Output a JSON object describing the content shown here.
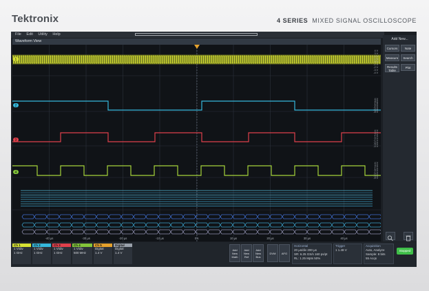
{
  "header": {
    "brand": "Tektronix",
    "series": "4 SERIES",
    "subtitle": "MIXED SIGNAL OSCILLOSCOPE"
  },
  "menu": [
    "File",
    "Edit",
    "Utility",
    "Help"
  ],
  "waveform_view": {
    "title": "Waveform View"
  },
  "side_panel": {
    "title": "Add New...",
    "buttons": [
      "Cursors",
      "Note",
      "Measure",
      "Search",
      "Results Table",
      "Plot"
    ]
  },
  "time_axis": {
    "labels": [
      "-40 µs",
      "-30 µs",
      "-20 µs",
      "-10 µs",
      "0 s",
      "10 µs",
      "20 µs",
      "30 µs",
      "40 µs"
    ]
  },
  "scale_labels": [
    "4 V",
    "3 V",
    "2 V",
    "1 V",
    "0 V",
    "-1 V",
    "-2 V",
    "-3 V",
    "-4 V"
  ],
  "channels": [
    {
      "name": "Ch 1",
      "color": "#d7e234",
      "lines": [
        "1 V/div",
        "1 GHz"
      ]
    },
    {
      "name": "Ch 2",
      "color": "#35b9dd",
      "lines": [
        "1 V/div",
        "1 GHz"
      ]
    },
    {
      "name": "Ch 3",
      "color": "#e0404b",
      "lines": [
        "1 V/div",
        "1 GHz"
      ]
    },
    {
      "name": "Ch 4",
      "color": "#83c53a",
      "lines": [
        "1 V/div",
        "500 MHz"
      ]
    },
    {
      "name": "Ch 5",
      "color": "#e5a12c",
      "lines": [
        "Digital",
        "1.4 V"
      ]
    },
    {
      "name": "Digital",
      "color": "#9aa1ab",
      "lines": [
        "Digital",
        "1.4 V"
      ]
    }
  ],
  "add_buttons": [
    "Add New Math",
    "Add New Ref",
    "Add New Bus"
  ],
  "dvm": "DVM",
  "afg": "AFG",
  "horizontal": {
    "title": "Horizontal",
    "rows": [
      "20 µs/div   200 µs",
      "SR: 6.25 GS/s   160 ps/pt",
      "RL: 1.25 Mpts   50%"
    ]
  },
  "trigger": {
    "title": "Trigger",
    "rows": [
      "1   1.48 V"
    ]
  },
  "acquisition": {
    "title": "Acquisition",
    "rows": [
      "Auto,   Analyze",
      "Sample: 8 bits",
      "55 Acqs"
    ]
  },
  "status": {
    "label": "Stopped"
  },
  "ch_markers": [
    "1",
    "2",
    "3",
    "4"
  ]
}
